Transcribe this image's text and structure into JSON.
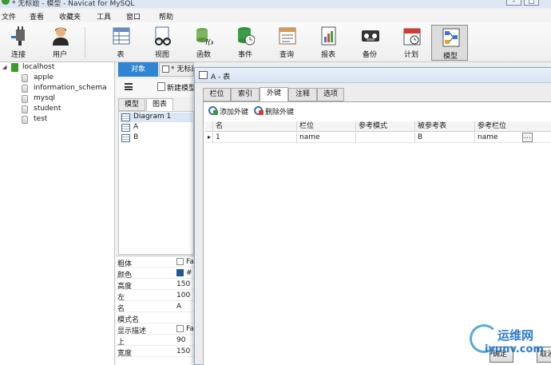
{
  "window": {
    "title": "* 无标题 - 模型 - Navicat for MySQL"
  },
  "menu": [
    "文件",
    "查看",
    "收藏夹",
    "工具",
    "窗口",
    "帮助"
  ],
  "toolbar": {
    "connect": "连接",
    "user": "用户",
    "table": "表",
    "view": "视图",
    "function": "函数",
    "event": "事件",
    "query": "查询",
    "report": "报表",
    "backup": "备份",
    "schedule": "计划",
    "model": "模型"
  },
  "nav": {
    "connection": "localhost",
    "databases": [
      "apple",
      "information_schema",
      "mysql",
      "student",
      "test"
    ]
  },
  "mid": {
    "objects_tab": "对象",
    "doc_tab": "* 无标题",
    "new_model": "新建模型",
    "subtabs": [
      "模型",
      "图表"
    ],
    "diagram": "Diagram 1",
    "tables": [
      "A",
      "B"
    ],
    "props": [
      {
        "k": "粗体",
        "v": "Fa",
        "type": "check"
      },
      {
        "k": "颜色",
        "v": "#",
        "type": "swatch"
      },
      {
        "k": "高度",
        "v": "150"
      },
      {
        "k": "左",
        "v": "100"
      },
      {
        "k": "名",
        "v": "A"
      },
      {
        "k": "模式名",
        "v": ""
      },
      {
        "k": "显示描述",
        "v": "Fa",
        "type": "check"
      },
      {
        "k": "上",
        "v": "90"
      },
      {
        "k": "宽度",
        "v": "150"
      }
    ]
  },
  "dialog": {
    "title": "A - 表",
    "tabs": [
      "栏位",
      "索引",
      "外键",
      "注释",
      "选项"
    ],
    "add_fk": "添加外键",
    "delete_fk": "删除外键",
    "columns": [
      "名",
      "栏位",
      "参考模式",
      "被参考表",
      "参考栏位"
    ],
    "rows": [
      {
        "marker": "▸",
        "name": "1",
        "field": "name",
        "ref_schema": "",
        "ref_table": "B",
        "ref_field": "name"
      }
    ],
    "ellipsis": "...",
    "ok": "确定",
    "cancel": "取消"
  },
  "watermark": {
    "cn": "运维网",
    "en": "iyunv.com"
  },
  "colors": {
    "accent": "#2f85d1",
    "swatch": "#20578f",
    "connection": "#3c9a2f"
  }
}
